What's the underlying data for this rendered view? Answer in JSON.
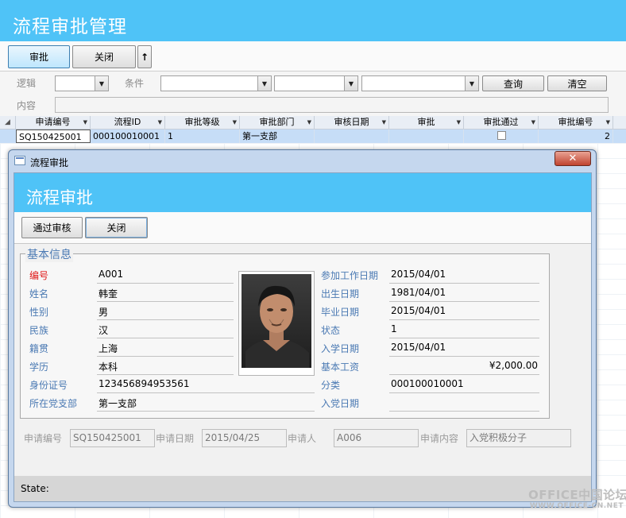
{
  "main": {
    "title": "流程审批管理",
    "toolbar": {
      "approve_label": "审批",
      "close_label": "关闭",
      "sort_label": "↑"
    },
    "filter": {
      "logic_label": "逻辑",
      "condition_label": "条件",
      "content_label": "内容",
      "query_label": "查询",
      "clear_label": "清空"
    },
    "grid": {
      "columns": [
        "申请编号",
        "流程ID",
        "审批等级",
        "审批部门",
        "审核日期",
        "审批",
        "审批通过",
        "审批编号"
      ],
      "row": {
        "apply_no": "SQ150425001",
        "flow_id": "000100010001",
        "level": "1",
        "dept": "第一支部",
        "review_date": "",
        "approve": "",
        "approved": false,
        "approve_no": "2"
      }
    }
  },
  "dialog": {
    "window_title": "流程审批",
    "header_title": "流程审批",
    "toolbar": {
      "pass_label": "通过审核",
      "close_label": "关闭"
    },
    "section_title": "基本信息",
    "fields_left": [
      {
        "label": "编号",
        "value": "A001"
      },
      {
        "label": "姓名",
        "value": "韩奎"
      },
      {
        "label": "性别",
        "value": "男"
      },
      {
        "label": "民族",
        "value": "汉"
      },
      {
        "label": "籍贯",
        "value": "上海"
      },
      {
        "label": "学历",
        "value": "本科"
      },
      {
        "label": "身份证号",
        "value": "123456894953561"
      },
      {
        "label": "所在党支部",
        "value": "第一支部"
      }
    ],
    "fields_right": [
      {
        "label": "参加工作日期",
        "value": "2015/04/01"
      },
      {
        "label": "出生日期",
        "value": "1981/04/01"
      },
      {
        "label": "毕业日期",
        "value": "2015/04/01"
      },
      {
        "label": "状态",
        "value": "1"
      },
      {
        "label": "入学日期",
        "value": "2015/04/01"
      },
      {
        "label": "基本工资",
        "value": "¥2,000.00"
      },
      {
        "label": "分类",
        "value": "000100010001"
      },
      {
        "label": "入党日期",
        "value": ""
      }
    ],
    "apply": [
      {
        "label": "申请编号",
        "value": "SQ150425001"
      },
      {
        "label": "申请日期",
        "value": "2015/04/25"
      },
      {
        "label": "申请人",
        "value": "A006"
      },
      {
        "label": "申请内容",
        "value": "入党积极分子"
      }
    ],
    "status_label": "State:"
  },
  "watermark": {
    "line1": "OFFICE中国论坛",
    "line2": "WWW.OFFICE-CN.NET"
  },
  "colors": {
    "header": "#4fc3f7",
    "label_blue": "#4a79b3",
    "label_red": "#e01b1b"
  }
}
